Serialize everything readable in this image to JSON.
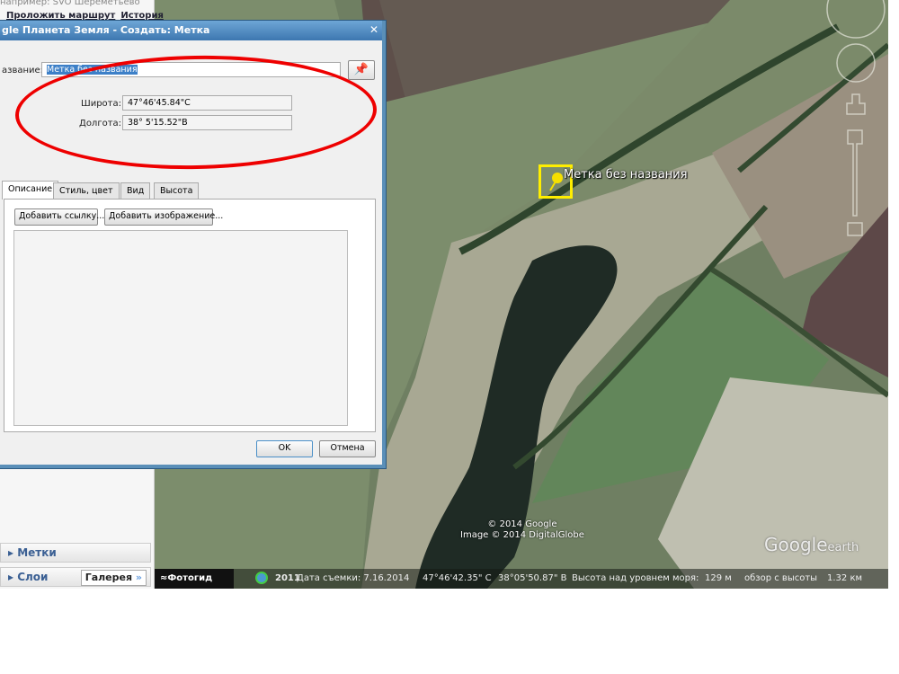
{
  "sidebar": {
    "search_hint": "например: SVO Шереметьево",
    "route_link": "Проложить маршрут",
    "history_link": "История",
    "places_label": "Метки",
    "layers_label": "Слои",
    "gallery_label": "Галерея",
    "gallery_arrow": "»"
  },
  "dialog": {
    "title": "gle Планета Земля - Создать: Метка",
    "close": "✕",
    "name_label": "азвание:",
    "name_value": "Метка без названия",
    "latitude_label": "Широта:",
    "latitude_value": "47°46'45.84\"С",
    "longitude_label": "Долгота:",
    "longitude_value": "38° 5'15.52\"В",
    "tabs": [
      {
        "label": "Описание"
      },
      {
        "label": "Стиль, цвет"
      },
      {
        "label": "Вид"
      },
      {
        "label": "Высота"
      }
    ],
    "add_link": "Добавить ссылку...",
    "add_image": "Добавить изображение...",
    "ok": "OK",
    "cancel": "Отмена"
  },
  "map": {
    "placemark_label": "Метка без названия",
    "copyright1": "© 2014 Google",
    "copyright2": "Image © 2014 DigitalGlobe",
    "logo_google": "Google",
    "logo_earth": "earth"
  },
  "statusbar": {
    "photoguide": "Фотогид",
    "year": "2011",
    "date": "Дата съемки: 7.16.2014",
    "lat": "47°46'42.35\" С",
    "lon": "38°05'50.87\" В",
    "elev_label": "Высота над уровнем моря:",
    "elev": "129 м",
    "eye_label": "обзор с высоты",
    "eye": "1.32 км"
  },
  "colors": {
    "accent": "#3d77b0",
    "annotation": "#e00000",
    "placemark": "#ffee00"
  }
}
